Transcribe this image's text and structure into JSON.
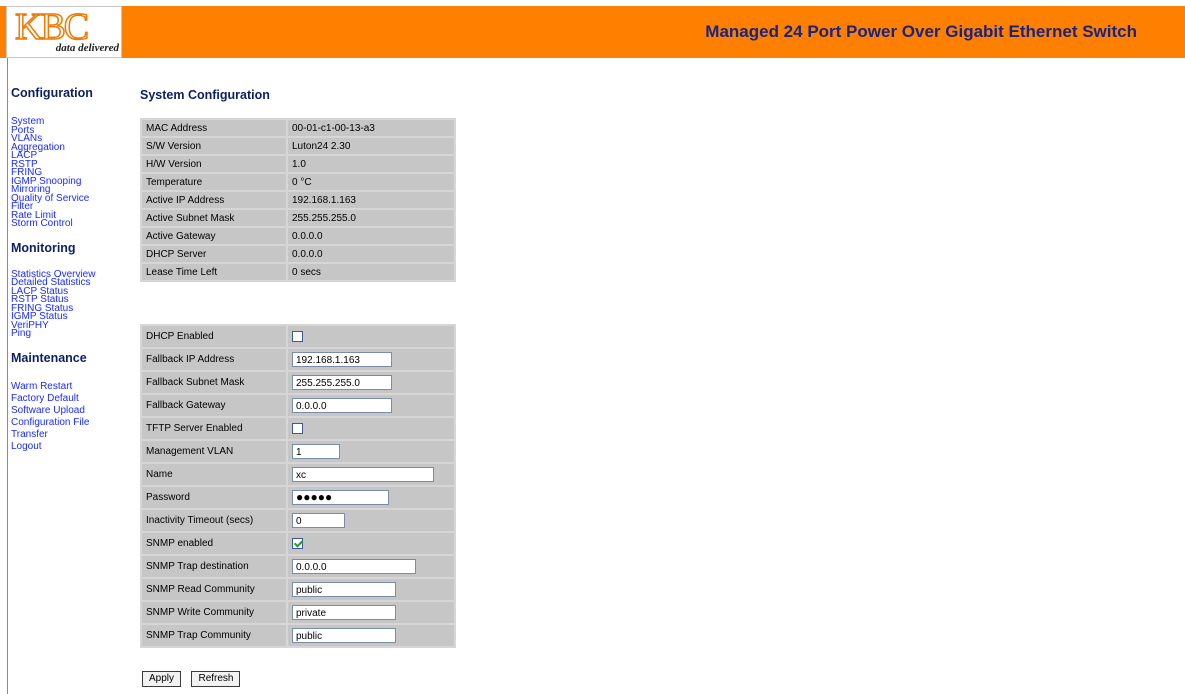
{
  "header": {
    "logo_text": "KBC",
    "logo_tagline": "data delivered",
    "title": "Managed 24 Port Power Over Gigabit Ethernet Switch"
  },
  "sidebar": {
    "sections": [
      {
        "heading": "Configuration",
        "items": [
          "System",
          "Ports",
          "VLANs",
          "Aggregation",
          "LACP",
          "RSTP",
          "FRING",
          "IGMP Snooping",
          "Mirroring",
          "Quality of Service",
          "Filter",
          "Rate Limit",
          "Storm Control"
        ]
      },
      {
        "heading": "Monitoring",
        "items": [
          "Statistics Overview",
          "Detailed Statistics",
          "LACP Status",
          "RSTP Status",
          "FRING Status",
          "IGMP Status",
          "VeriPHY",
          "Ping"
        ]
      },
      {
        "heading": "Maintenance",
        "items": [
          "Warm Restart",
          "Factory Default",
          "Software Upload",
          "Configuration File",
          "Transfer",
          "Logout"
        ]
      }
    ]
  },
  "page": {
    "heading": "System Configuration"
  },
  "info": [
    {
      "label": "MAC Address",
      "value": "00-01-c1-00-13-a3"
    },
    {
      "label": "S/W Version",
      "value": "Luton24 2.30"
    },
    {
      "label": "H/W Version",
      "value": "1.0"
    },
    {
      "label": "Temperature",
      "value": "0 °C"
    },
    {
      "label": "Active IP Address",
      "value": "192.168.1.163"
    },
    {
      "label": "Active Subnet Mask",
      "value": "255.255.255.0"
    },
    {
      "label": "Active Gateway",
      "value": "0.0.0.0"
    },
    {
      "label": "DHCP Server",
      "value": "0.0.0.0"
    },
    {
      "label": "Lease Time Left",
      "value": "0 secs"
    }
  ],
  "form": [
    {
      "label": "DHCP Enabled",
      "type": "checkbox",
      "checked": false
    },
    {
      "label": "Fallback IP Address",
      "type": "text",
      "value": "192.168.1.163"
    },
    {
      "label": "Fallback Subnet Mask",
      "type": "text",
      "value": "255.255.255.0"
    },
    {
      "label": "Fallback Gateway",
      "type": "text",
      "value": "0.0.0.0"
    },
    {
      "label": "TFTP Server Enabled",
      "type": "checkbox",
      "checked": false
    },
    {
      "label": "Management VLAN",
      "type": "text",
      "value": "1"
    },
    {
      "label": "Name",
      "type": "text",
      "value": "xc"
    },
    {
      "label": "Password",
      "type": "password",
      "value": "●●●●●"
    },
    {
      "label": "Inactivity Timeout (secs)",
      "type": "text",
      "value": "0"
    },
    {
      "label": "SNMP enabled",
      "type": "checkbox",
      "checked": true
    },
    {
      "label": "SNMP Trap destination",
      "type": "text",
      "value": "0.0.0.0"
    },
    {
      "label": "SNMP Read Community",
      "type": "text",
      "value": "public"
    },
    {
      "label": "SNMP Write Community",
      "type": "text",
      "value": "private"
    },
    {
      "label": "SNMP Trap Community",
      "type": "text",
      "value": "public"
    }
  ],
  "buttons": {
    "apply": "Apply",
    "refresh": "Refresh"
  },
  "colors": {
    "header_bg": "#ff8000",
    "title": "#1a237e",
    "link": "#1a2cff",
    "cell_bg": "#c6c6c6"
  }
}
